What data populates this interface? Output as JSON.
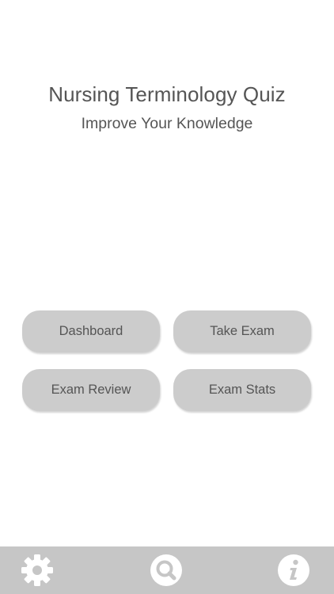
{
  "header": {
    "title": "Nursing Terminology Quiz",
    "subtitle": "Improve Your Knowledge"
  },
  "buttons": {
    "dashboard": "Dashboard",
    "take_exam": "Take Exam",
    "exam_review": "Exam Review",
    "exam_stats": "Exam Stats"
  },
  "tabbar": {
    "items": [
      {
        "icon": "gear-icon"
      },
      {
        "icon": "search-icon"
      },
      {
        "icon": "info-icon"
      }
    ]
  },
  "colors": {
    "text": "#555555",
    "button_bg": "#cccccc",
    "tabbar_bg": "#c6c6c6",
    "icon": "#ffffff"
  }
}
